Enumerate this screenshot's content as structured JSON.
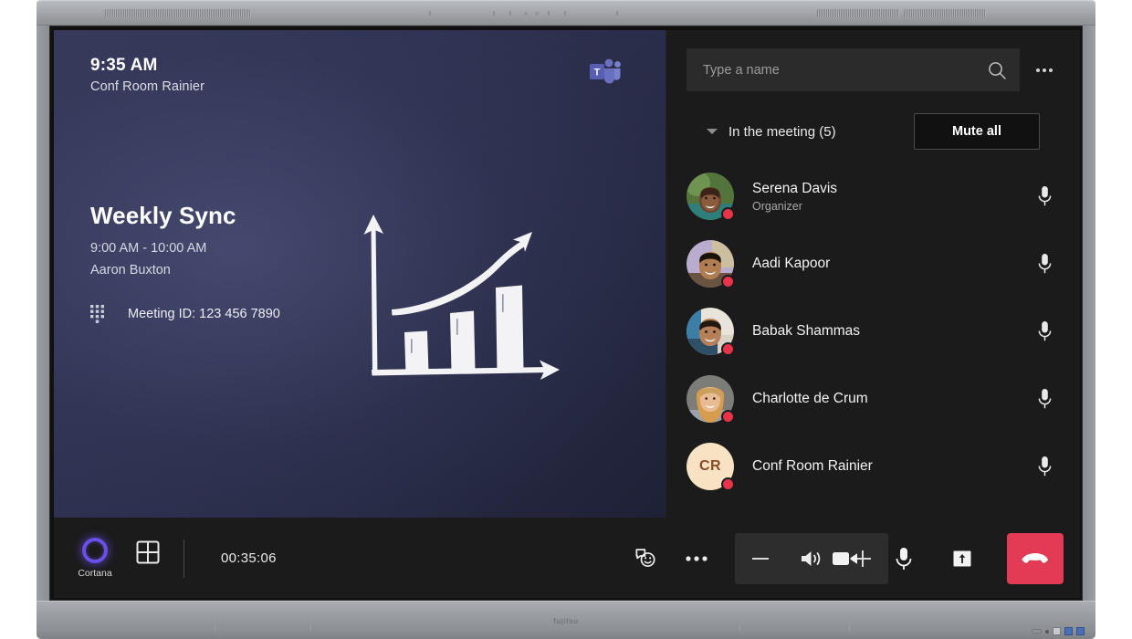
{
  "device": {
    "brand_label": "fujitsu",
    "icons": {
      "speaker_grille": "speaker-grille",
      "sensor": "sensor-mark"
    }
  },
  "stage": {
    "clock": "9:35 AM",
    "room_name": "Conf Room Rainier",
    "teams_logo_icon": "microsoft-teams-logo",
    "meeting": {
      "title": "Weekly Sync",
      "time_range": "9:00 AM - 10:00 AM",
      "organizer": "Aaron Buxton",
      "dialpad_icon": "dialpad-icon",
      "meeting_id": "Meeting ID: 123 456 7890"
    },
    "artwork_icon": "bar-chart-growth-illustration"
  },
  "roster": {
    "search": {
      "placeholder": "Type a name",
      "value": "",
      "search_icon": "search-icon"
    },
    "more_options_icon": "more-options-icon",
    "section": {
      "caret_icon": "chevron-down-icon",
      "title": "In the meeting (5)",
      "mute_all_label": "Mute all"
    },
    "mic_icon": "microphone-icon",
    "people": [
      {
        "name": "Serena Davis",
        "role": "Organizer",
        "avatar_type": "photo",
        "avatar_icon": "avatar-photo-serena",
        "presence": "busy",
        "presence_color": "#e8334a"
      },
      {
        "name": "Aadi Kapoor",
        "role": "",
        "avatar_type": "photo",
        "avatar_icon": "avatar-photo-aadi",
        "presence": "busy",
        "presence_color": "#e8334a"
      },
      {
        "name": "Babak Shammas",
        "role": "",
        "avatar_type": "photo",
        "avatar_icon": "avatar-photo-babak",
        "presence": "busy",
        "presence_color": "#e8334a"
      },
      {
        "name": "Charlotte de Crum",
        "role": "",
        "avatar_type": "photo",
        "avatar_icon": "avatar-photo-charlotte",
        "presence": "busy",
        "presence_color": "#e8334a"
      },
      {
        "name": "Conf Room Rainier",
        "role": "",
        "avatar_type": "initials",
        "initials": "CR",
        "avatar_icon": "avatar-initials-conf-room",
        "presence": "busy",
        "presence_color": "#e8334a"
      }
    ]
  },
  "bottombar": {
    "cortana_label": "Cortana",
    "cortana_icon": "cortana-ring-icon",
    "cortana_color": "#6a4fe8",
    "layout_icon": "gallery-layout-icon",
    "timer": "00:35:06",
    "reactions_icon": "reactions-chat-icon",
    "more_icon": "more-options-icon",
    "volume_down_icon": "minus-icon",
    "volume_icon": "speaker-volume-icon",
    "volume_up_icon": "plus-icon",
    "camera_icon": "camera-icon",
    "mic_icon": "microphone-icon",
    "share_icon": "share-screen-icon",
    "hangup_icon": "hang-up-icon",
    "hangup_color": "#e33a56"
  }
}
